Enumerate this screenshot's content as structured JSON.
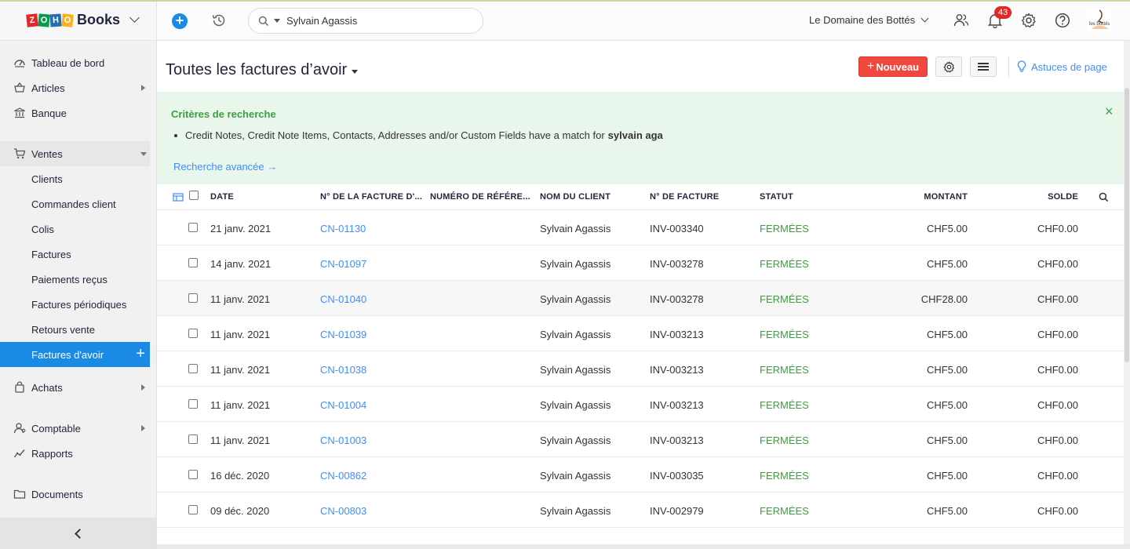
{
  "brand": {
    "zoho": [
      "Z",
      "O",
      "H",
      "O"
    ],
    "product": "Books"
  },
  "sidebar": {
    "items": [
      {
        "label": "Tableau de bord",
        "icon": "dashboard-icon"
      },
      {
        "label": "Articles",
        "icon": "basket-icon"
      },
      {
        "label": "Banque",
        "icon": "bank-icon"
      },
      {
        "label": "Ventes",
        "icon": "cart-icon"
      },
      {
        "label": "Clients"
      },
      {
        "label": "Commandes client"
      },
      {
        "label": "Colis"
      },
      {
        "label": "Factures"
      },
      {
        "label": "Paiements reçus"
      },
      {
        "label": "Factures périodiques"
      },
      {
        "label": "Retours vente"
      },
      {
        "label": "Factures d'avoir"
      },
      {
        "label": "Achats",
        "icon": "bag-icon"
      },
      {
        "label": "Comptable",
        "icon": "accountant-icon"
      },
      {
        "label": "Rapports",
        "icon": "reports-icon"
      },
      {
        "label": "Documents",
        "icon": "folder-icon"
      }
    ]
  },
  "topbar": {
    "search_value": "Sylvain Agassis",
    "organization": "Le Domaine des Bottés",
    "notifications_count": "43",
    "avatar_text": "les bottés"
  },
  "page": {
    "title": "Toutes les factures d’avoir",
    "new_button": "Nouveau",
    "tips_link": "Astuces de page"
  },
  "criteria": {
    "title": "Critères de recherche",
    "text": "Credit Notes, Credit Note Items, Contacts, Addresses and/or Custom Fields have a match for",
    "term": "sylvain aga",
    "advanced": "Recherche avancée"
  },
  "table": {
    "headers": {
      "date": "DATE",
      "number": "N° DE LA FACTURE D'...",
      "reference": "NUMÉRO DE RÉFÉRE...",
      "customer": "NOM DU CLIENT",
      "invoice": "N° DE FACTURE",
      "status": "STATUT",
      "amount": "MONTANT",
      "balance": "SOLDE"
    },
    "rows": [
      {
        "date": "21 janv. 2021",
        "number": "CN-01130",
        "reference": "",
        "customer": "Sylvain Agassis",
        "invoice": "INV-003340",
        "status": "FERMÉES",
        "amount": "CHF5.00",
        "balance": "CHF0.00"
      },
      {
        "date": "14 janv. 2021",
        "number": "CN-01097",
        "reference": "",
        "customer": "Sylvain Agassis",
        "invoice": "INV-003278",
        "status": "FERMÉES",
        "amount": "CHF5.00",
        "balance": "CHF0.00"
      },
      {
        "date": "11 janv. 2021",
        "number": "CN-01040",
        "reference": "",
        "customer": "Sylvain Agassis",
        "invoice": "INV-003278",
        "status": "FERMÉES",
        "amount": "CHF28.00",
        "balance": "CHF0.00"
      },
      {
        "date": "11 janv. 2021",
        "number": "CN-01039",
        "reference": "",
        "customer": "Sylvain Agassis",
        "invoice": "INV-003213",
        "status": "FERMÉES",
        "amount": "CHF5.00",
        "balance": "CHF0.00"
      },
      {
        "date": "11 janv. 2021",
        "number": "CN-01038",
        "reference": "",
        "customer": "Sylvain Agassis",
        "invoice": "INV-003213",
        "status": "FERMÉES",
        "amount": "CHF5.00",
        "balance": "CHF0.00"
      },
      {
        "date": "11 janv. 2021",
        "number": "CN-01004",
        "reference": "",
        "customer": "Sylvain Agassis",
        "invoice": "INV-003213",
        "status": "FERMÉES",
        "amount": "CHF5.00",
        "balance": "CHF0.00"
      },
      {
        "date": "11 janv. 2021",
        "number": "CN-01003",
        "reference": "",
        "customer": "Sylvain Agassis",
        "invoice": "INV-003213",
        "status": "FERMÉES",
        "amount": "CHF5.00",
        "balance": "CHF0.00"
      },
      {
        "date": "16 déc. 2020",
        "number": "CN-00862",
        "reference": "",
        "customer": "Sylvain Agassis",
        "invoice": "INV-003035",
        "status": "FERMÉES",
        "amount": "CHF5.00",
        "balance": "CHF0.00"
      },
      {
        "date": "09 déc. 2020",
        "number": "CN-00803",
        "reference": "",
        "customer": "Sylvain Agassis",
        "invoice": "INV-002979",
        "status": "FERMÉES",
        "amount": "CHF5.00",
        "balance": "CHF0.00"
      }
    ]
  },
  "colors": {
    "accent": "#1a8ae5",
    "new_button": "#f0483e",
    "status_closed": "#3d9e3f",
    "link": "#408dfb",
    "criteria_bg": "#e8f6ec"
  }
}
